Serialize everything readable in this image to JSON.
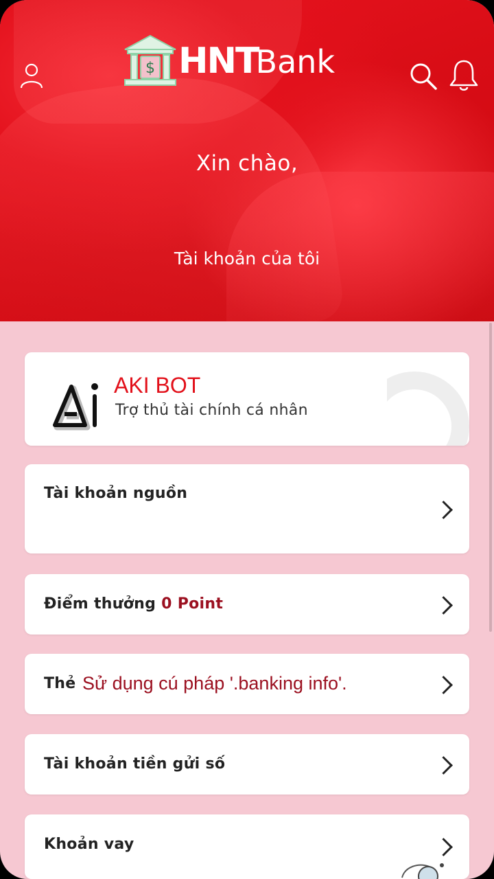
{
  "app": {
    "logo_hnt": "HNT",
    "logo_bank": "Bank"
  },
  "header": {
    "icons": {
      "profile": "user-icon",
      "search": "search-icon",
      "notifications": "bell-icon"
    },
    "greeting": "Xin chào,",
    "my_account": "Tài khoản của tôi"
  },
  "aki_bot": {
    "title": "AKI BOT",
    "subtitle": "Trợ thủ tài chính cá nhân"
  },
  "menu": {
    "source_account": "Tài khoản nguồn",
    "reward_points_label": "Điểm thưởng",
    "reward_points_value": "0 Point",
    "card_label": "Thẻ",
    "card_hint": "Sử dụng cú pháp '.banking info'.",
    "deposit_account": "Tài khoản tiền gửi số",
    "loan": "Khoản vay"
  },
  "colors": {
    "brand_red": "#e2101a",
    "accent_dark_red": "#9b1020",
    "background_pink": "#f6c8d2"
  }
}
